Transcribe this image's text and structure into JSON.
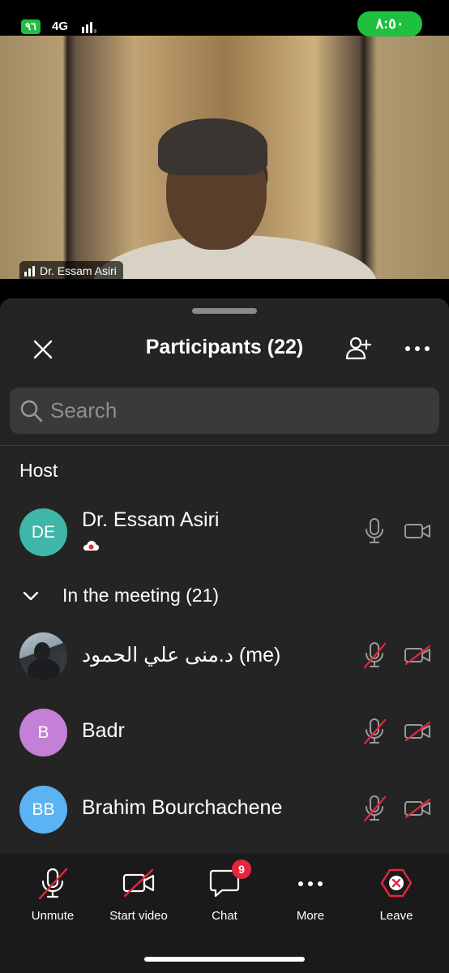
{
  "status_bar": {
    "battery": "٩٦",
    "network": "4G",
    "time": "٨:٥٠"
  },
  "video": {
    "speaker_name": "Dr. Essam Asiri"
  },
  "panel": {
    "title": "Participants (22)",
    "search_placeholder": "Search",
    "host_section": "Host",
    "host": {
      "initials": "DE",
      "name": "Dr. Essam Asiri",
      "avatar_color": "#3fb7a8",
      "mic": "on",
      "video": "on"
    },
    "in_meeting_label": "In the meeting (21)",
    "participants": [
      {
        "initials": "",
        "name": "د.منى علي الحمود (me)",
        "avatar_color": "photo",
        "mic": "muted",
        "video": "off"
      },
      {
        "initials": "B",
        "name": "Badr",
        "avatar_color": "#c47fd6",
        "mic": "muted",
        "video": "off"
      },
      {
        "initials": "BB",
        "name": "Brahim Bourchachene",
        "avatar_color": "#5ab3f2",
        "mic": "muted",
        "video": "off"
      }
    ]
  },
  "toolbar": {
    "unmute": "Unmute",
    "start_video": "Start video",
    "chat": "Chat",
    "chat_badge": "9",
    "more": "More",
    "leave": "Leave"
  },
  "colors": {
    "accent_green": "#1fbf3f",
    "muted_red": "#e5263c",
    "sheet_bg": "#242424"
  }
}
